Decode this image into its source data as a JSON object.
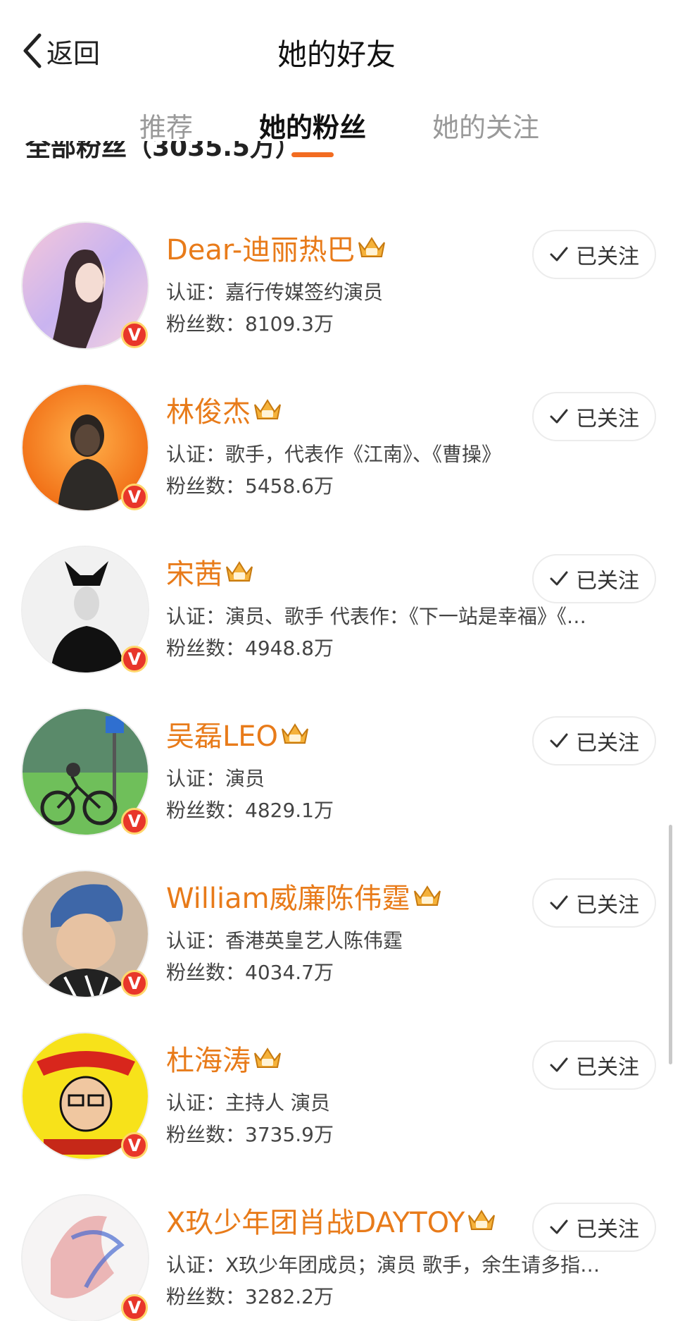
{
  "header": {
    "back_label": "返回",
    "title": "她的好友"
  },
  "tabs": [
    {
      "label": "推荐",
      "active": false
    },
    {
      "label": "她的粉丝",
      "active": true
    },
    {
      "label": "她的关注",
      "active": false
    }
  ],
  "section_header": "全部粉丝（3035.5万）",
  "accent_color": "#f26c21",
  "name_color": "#e87b1a",
  "icons": {
    "back": "chevron-left-icon",
    "verified": "verified-v-badge-icon",
    "crown": "crown-icon",
    "check": "check-icon"
  },
  "users": [
    {
      "name": "Dear-迪丽热巴",
      "cert": "认证：嘉行传媒签约演员",
      "fans": "粉丝数：8109.3万",
      "follow_label": "已关注",
      "verified": "V"
    },
    {
      "name": "林俊杰",
      "cert": "认证：歌手，代表作《江南》、《曹操》",
      "fans": "粉丝数：5458.6万",
      "follow_label": "已关注",
      "verified": "V"
    },
    {
      "name": "宋茜",
      "cert": "认证：演员、歌手 代表作：《下一站是幸福》《…",
      "fans": "粉丝数：4948.8万",
      "follow_label": "已关注",
      "verified": "V"
    },
    {
      "name": "吴磊LEO",
      "cert": "认证：演员",
      "fans": "粉丝数：4829.1万",
      "follow_label": "已关注",
      "verified": "V"
    },
    {
      "name": "William威廉陈伟霆",
      "cert": "认证：香港英皇艺人陈伟霆",
      "fans": "粉丝数：4034.7万",
      "follow_label": "已关注",
      "verified": "V"
    },
    {
      "name": "杜海涛",
      "cert": "认证：主持人 演员",
      "fans": "粉丝数：3735.9万",
      "follow_label": "已关注",
      "verified": "V"
    },
    {
      "name": "X玖少年团肖战DAYTOY",
      "cert": "认证：X玖少年团成员；演员 歌手，余生请多指…",
      "fans": "粉丝数：3282.2万",
      "follow_label": "已关注",
      "verified": "V"
    }
  ]
}
